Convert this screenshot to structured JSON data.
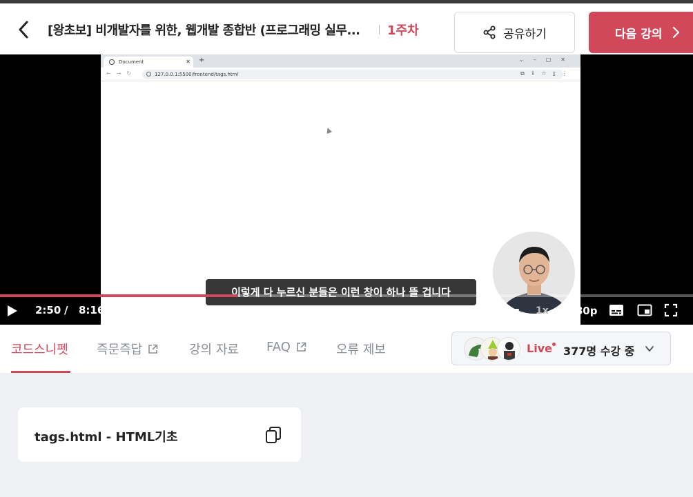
{
  "header": {
    "course_title": "[왕초보] 비개발자를 위한, 웹개발 종합반 (프로그래밍 실무...",
    "week": "1주차",
    "share_label": "공유하기",
    "next_label": "다음 강의"
  },
  "video": {
    "browser_tab_title": "Document",
    "browser_url": "127.0.0.1:5500/frontend/tags.html",
    "subtitle": "이렇게 다 누르신 분들은 이런 창이 하나 뜰 겁니다",
    "current_time": "2:50",
    "time_separator": "/",
    "duration": "8:16",
    "progress_fraction": 0.343,
    "volume_fraction": 1.0,
    "speed": "1x",
    "quality": "1080p"
  },
  "tabs": [
    {
      "label": "코드스니펫",
      "active": true,
      "external": false
    },
    {
      "label": "즉문즉답",
      "active": false,
      "external": true
    },
    {
      "label": "강의 자료",
      "active": false,
      "external": false
    },
    {
      "label": "FAQ",
      "active": false,
      "external": true
    },
    {
      "label": "오류 제보",
      "active": false,
      "external": false
    }
  ],
  "live": {
    "label": "Live",
    "count_text": "377명 수강 중"
  },
  "snippet": {
    "label": "tags.html - HTML기초"
  },
  "colors": {
    "accent": "#d1485b",
    "background": "#eef0f3"
  }
}
